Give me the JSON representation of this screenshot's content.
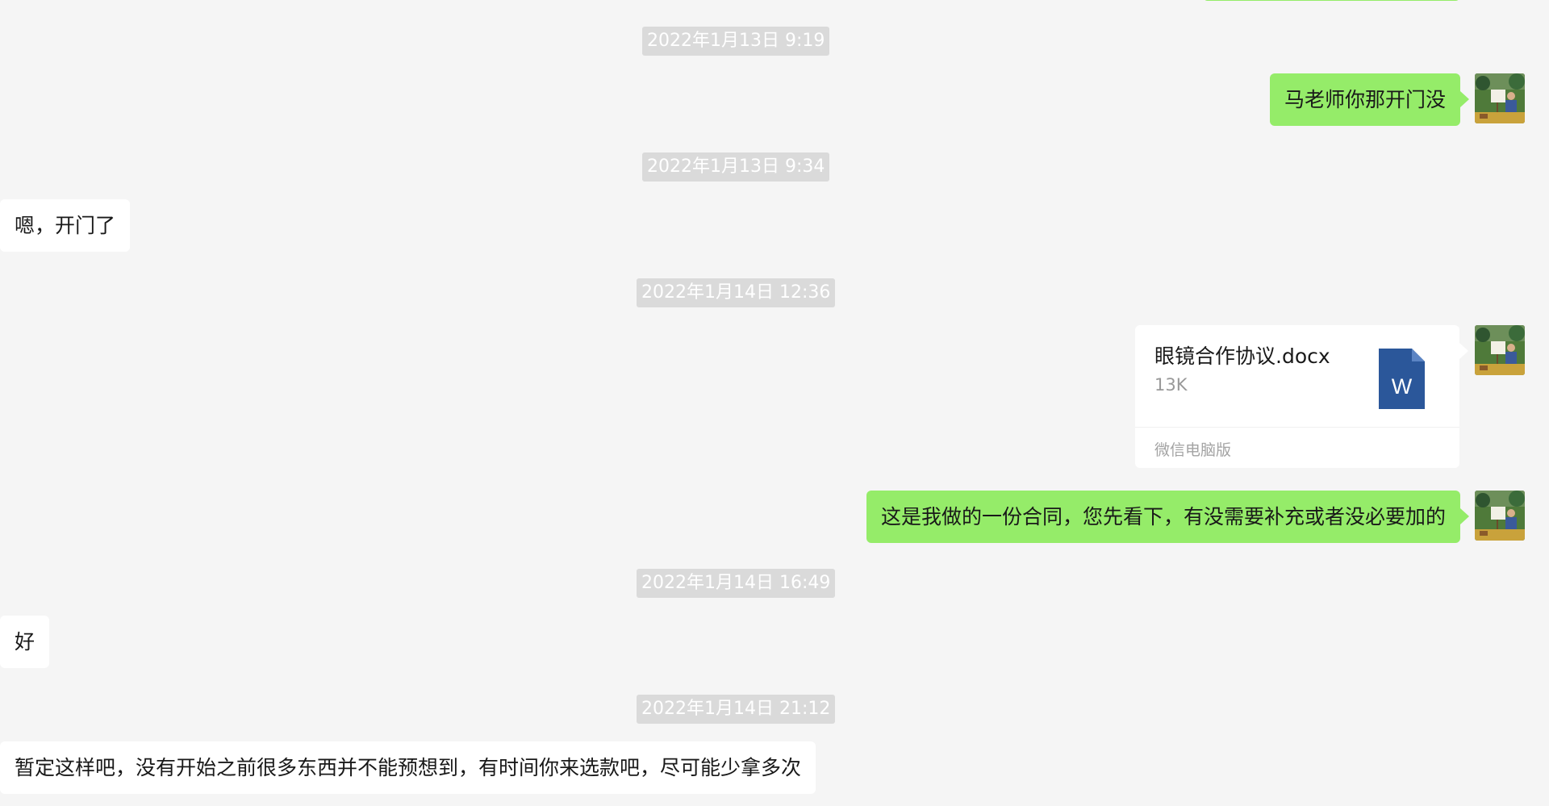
{
  "conversation": {
    "messages": [
      {
        "kind": "timestamp",
        "text": "2022年1月13日 9:19"
      },
      {
        "kind": "outgoing",
        "text": "马老师你那开门没"
      },
      {
        "kind": "timestamp",
        "text": "2022年1月13日 9:34"
      },
      {
        "kind": "incoming",
        "text": "嗯，开门了"
      },
      {
        "kind": "timestamp",
        "text": "2022年1月14日 12:36"
      },
      {
        "kind": "outgoing-file",
        "file_name": "眼镜合作协议.docx",
        "file_size": "13K",
        "source": "微信电脑版",
        "file_icon": "word-doc-icon",
        "icon_letter": "W"
      },
      {
        "kind": "outgoing",
        "text": "这是我做的一份合同，您先看下，有没需要补充或者没必要加的"
      },
      {
        "kind": "timestamp",
        "text": "2022年1月14日 16:49"
      },
      {
        "kind": "incoming",
        "text": "好"
      },
      {
        "kind": "timestamp",
        "text": "2022年1月14日 21:12"
      },
      {
        "kind": "incoming",
        "text": "暂定这样吧，没有开始之前很多东西并不能预想到，有时间你来选款吧，尽可能少拿多次"
      }
    ]
  },
  "colors": {
    "background": "#f5f5f5",
    "outgoing_bubble": "#95ec69",
    "incoming_bubble": "#ffffff",
    "timestamp_bg": "#dadada",
    "word_icon": "#2b579a"
  }
}
